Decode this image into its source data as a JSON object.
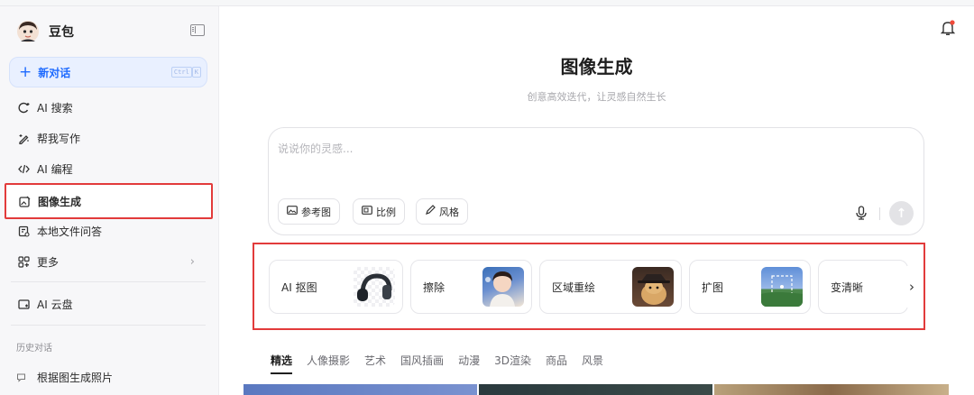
{
  "app": {
    "name": "豆包"
  },
  "sidebar": {
    "new_chat": {
      "label": "新对话",
      "shortcut": [
        "Ctrl",
        "K"
      ]
    },
    "items": [
      {
        "label": "AI 搜索",
        "icon": "search-spark-icon"
      },
      {
        "label": "帮我写作",
        "icon": "pen-spark-icon"
      },
      {
        "label": "AI 编程",
        "icon": "code-icon"
      },
      {
        "label": "图像生成",
        "icon": "image-edit-icon",
        "active": true
      },
      {
        "label": "本地文件问答",
        "icon": "file-question-icon"
      },
      {
        "label": "更多",
        "icon": "grid-more-icon"
      }
    ],
    "cloud": {
      "label": "AI 云盘",
      "icon": "cloud-drive-icon"
    },
    "history_title": "历史对话",
    "history": [
      {
        "label": "根据图生成照片"
      }
    ]
  },
  "main": {
    "title": "图像生成",
    "subtitle": "创意高效迭代，让灵感自然生长",
    "prompt": {
      "placeholder": "说说你的灵感...",
      "chips": [
        {
          "label": "参考图",
          "icon": "reference-image-icon"
        },
        {
          "label": "比例",
          "icon": "ratio-icon"
        },
        {
          "label": "风格",
          "icon": "brush-icon"
        }
      ]
    },
    "tools": [
      {
        "label": "AI 抠图"
      },
      {
        "label": "擦除"
      },
      {
        "label": "区域重绘"
      },
      {
        "label": "扩图"
      },
      {
        "label": "变清晰"
      }
    ],
    "tabs": [
      "精选",
      "人像摄影",
      "艺术",
      "国风插画",
      "动漫",
      "3D渲染",
      "商品",
      "风景"
    ],
    "active_tab": "精选"
  },
  "colors": {
    "accent": "#1f6bff",
    "highlight_border": "#e23b3b",
    "sidebar_bg": "#f7f7f9"
  }
}
